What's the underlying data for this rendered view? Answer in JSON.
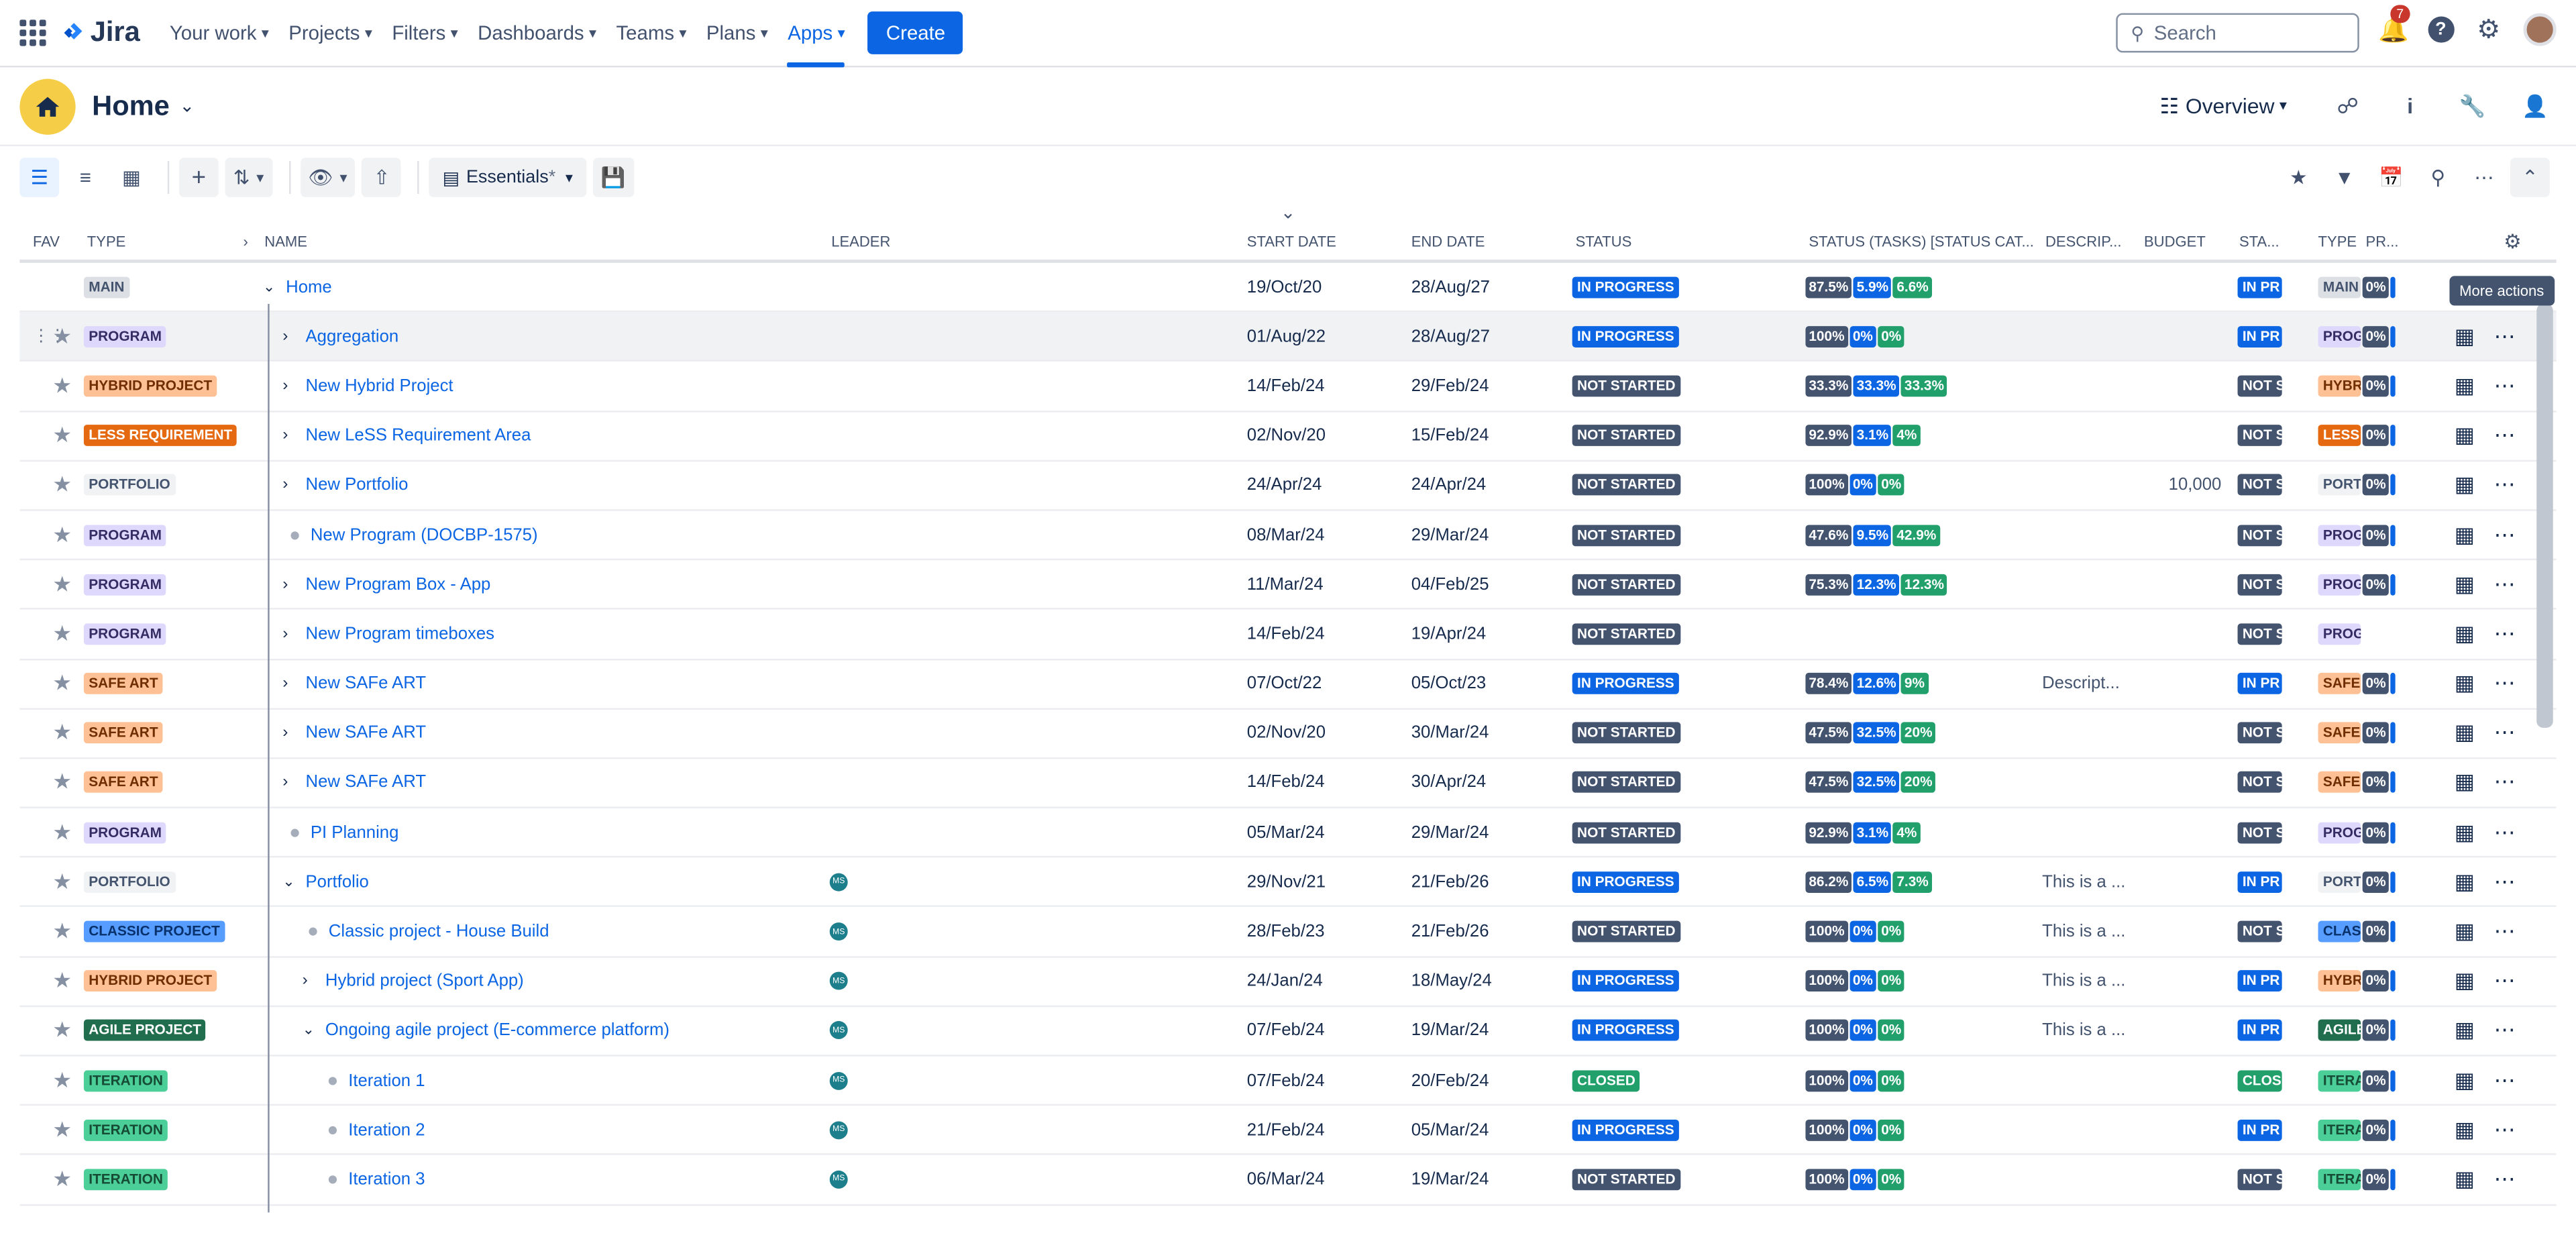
{
  "topnav": {
    "logo": "Jira",
    "items": [
      {
        "label": "Your work"
      },
      {
        "label": "Projects"
      },
      {
        "label": "Filters"
      },
      {
        "label": "Dashboards"
      },
      {
        "label": "Teams"
      },
      {
        "label": "Plans"
      },
      {
        "label": "Apps"
      }
    ],
    "create_label": "Create",
    "search_placeholder": "Search",
    "notification_count": "7"
  },
  "header": {
    "title": "Home",
    "view_label": "Overview"
  },
  "toolbar": {
    "view_name": "Essentials",
    "view_modified_mark": "*"
  },
  "columns": {
    "fav": "FAV",
    "type": "TYPE",
    "name": "NAME",
    "leader": "LEADER",
    "start_date": "START DATE",
    "end_date": "END DATE",
    "status": "STATUS",
    "status_tasks": "STATUS (TASKS) [STATUS CAT...",
    "description": "DESCRIP...",
    "budget": "BUDGET",
    "sta": "STA...",
    "type2": "TYPE",
    "pr": "PR..."
  },
  "tooltip": "More actions",
  "rows": [
    {
      "type": "MAIN",
      "name": "Home",
      "start": "19/Oct/20",
      "end": "28/Aug/27",
      "status": "IN PROGRESS",
      "p": [
        "87.5%",
        "5.9%",
        "6.6%"
      ],
      "desc": "",
      "budget": "",
      "sta": "IN PR",
      "type_short": "MAIN",
      "pr": "0%"
    },
    {
      "type": "PROGRAM",
      "name": "Aggregation",
      "start": "01/Aug/22",
      "end": "28/Aug/27",
      "status": "IN PROGRESS",
      "p": [
        "100%",
        "0%",
        "0%"
      ],
      "desc": "",
      "budget": "",
      "sta": "IN PR",
      "type_short": "PROG",
      "pr": "0%"
    },
    {
      "type": "HYBRID PROJECT",
      "name": "New Hybrid Project",
      "start": "14/Feb/24",
      "end": "29/Feb/24",
      "status": "NOT STARTED",
      "p": [
        "33.3%",
        "33.3%",
        "33.3%"
      ],
      "desc": "",
      "budget": "",
      "sta": "NOT S",
      "type_short": "HYBR",
      "pr": "0%"
    },
    {
      "type": "LESS REQUIREMENT",
      "name": "New LeSS Requirement Area",
      "start": "02/Nov/20",
      "end": "15/Feb/24",
      "status": "NOT STARTED",
      "p": [
        "92.9%",
        "3.1%",
        "4%"
      ],
      "desc": "",
      "budget": "",
      "sta": "NOT S",
      "type_short": "LESS",
      "pr": "0%"
    },
    {
      "type": "PORTFOLIO",
      "name": "New Portfolio",
      "start": "24/Apr/24",
      "end": "24/Apr/24",
      "status": "NOT STARTED",
      "p": [
        "100%",
        "0%",
        "0%"
      ],
      "desc": "",
      "budget": "10,000",
      "sta": "NOT S",
      "type_short": "PORT",
      "pr": "0%"
    },
    {
      "type": "PROGRAM",
      "name": "New Program (DOCBP-1575)",
      "start": "08/Mar/24",
      "end": "29/Mar/24",
      "status": "NOT STARTED",
      "p": [
        "47.6%",
        "9.5%",
        "42.9%"
      ],
      "desc": "",
      "budget": "",
      "sta": "NOT S",
      "type_short": "PROG",
      "pr": "0%"
    },
    {
      "type": "PROGRAM",
      "name": "New Program Box - App",
      "start": "11/Mar/24",
      "end": "04/Feb/25",
      "status": "NOT STARTED",
      "p": [
        "75.3%",
        "12.3%",
        "12.3%"
      ],
      "desc": "",
      "budget": "",
      "sta": "NOT S",
      "type_short": "PROG",
      "pr": "0%"
    },
    {
      "type": "PROGRAM",
      "name": "New Program timeboxes",
      "start": "14/Feb/24",
      "end": "19/Apr/24",
      "status": "NOT STARTED",
      "p": [
        "",
        "",
        ""
      ],
      "desc": "",
      "budget": "",
      "sta": "NOT S",
      "type_short": "PROG",
      "pr": ""
    },
    {
      "type": "SAFE ART",
      "name": "New SAFe ART",
      "start": "07/Oct/22",
      "end": "05/Oct/23",
      "status": "IN PROGRESS",
      "p": [
        "78.4%",
        "12.6%",
        "9%"
      ],
      "desc": "Descript...",
      "budget": "",
      "sta": "IN PR",
      "type_short": "SAFE",
      "pr": "0%"
    },
    {
      "type": "SAFE ART",
      "name": "New SAFe ART",
      "start": "02/Nov/20",
      "end": "30/Mar/24",
      "status": "NOT STARTED",
      "p": [
        "47.5%",
        "32.5%",
        "20%"
      ],
      "desc": "",
      "budget": "",
      "sta": "NOT S",
      "type_short": "SAFE",
      "pr": "0%"
    },
    {
      "type": "SAFE ART",
      "name": "New SAFe ART",
      "start": "14/Feb/24",
      "end": "30/Apr/24",
      "status": "NOT STARTED",
      "p": [
        "47.5%",
        "32.5%",
        "20%"
      ],
      "desc": "",
      "budget": "",
      "sta": "NOT S",
      "type_short": "SAFE",
      "pr": "0%"
    },
    {
      "type": "PROGRAM",
      "name": "PI Planning",
      "start": "05/Mar/24",
      "end": "29/Mar/24",
      "status": "NOT STARTED",
      "p": [
        "92.9%",
        "3.1%",
        "4%"
      ],
      "desc": "",
      "budget": "",
      "sta": "NOT S",
      "type_short": "PROG",
      "pr": "0%"
    },
    {
      "type": "PORTFOLIO",
      "name": "Portfolio",
      "leader": "MS",
      "start": "29/Nov/21",
      "end": "21/Feb/26",
      "status": "IN PROGRESS",
      "p": [
        "86.2%",
        "6.5%",
        "7.3%"
      ],
      "desc": "This is a ...",
      "budget": "",
      "sta": "IN PR",
      "type_short": "PORT",
      "pr": "0%"
    },
    {
      "type": "CLASSIC PROJECT",
      "name": "Classic project - House Build",
      "leader": "MS",
      "start": "28/Feb/23",
      "end": "21/Feb/26",
      "status": "NOT STARTED",
      "p": [
        "100%",
        "0%",
        "0%"
      ],
      "desc": "This is a ...",
      "budget": "",
      "sta": "NOT S",
      "type_short": "CLAS",
      "pr": "0%"
    },
    {
      "type": "HYBRID PROJECT",
      "name": "Hybrid project (Sport App)",
      "leader": "MS",
      "start": "24/Jan/24",
      "end": "18/May/24",
      "status": "IN PROGRESS",
      "p": [
        "100%",
        "0%",
        "0%"
      ],
      "desc": "This is a ...",
      "budget": "",
      "sta": "IN PR",
      "type_short": "HYBR",
      "pr": "0%"
    },
    {
      "type": "AGILE PROJECT",
      "name": "Ongoing agile project (E-commerce platform)",
      "leader": "MS",
      "start": "07/Feb/24",
      "end": "19/Mar/24",
      "status": "IN PROGRESS",
      "p": [
        "100%",
        "0%",
        "0%"
      ],
      "desc": "This is a ...",
      "budget": "",
      "sta": "IN PR",
      "type_short": "AGILE",
      "pr": "0%"
    },
    {
      "type": "ITERATION",
      "name": "Iteration 1",
      "leader": "MS",
      "start": "07/Feb/24",
      "end": "20/Feb/24",
      "status": "CLOSED",
      "p": [
        "100%",
        "0%",
        "0%"
      ],
      "desc": "",
      "budget": "",
      "sta": "CLOS",
      "type_short": "ITERA",
      "pr": "0%"
    },
    {
      "type": "ITERATION",
      "name": "Iteration 2",
      "leader": "MS",
      "start": "21/Feb/24",
      "end": "05/Mar/24",
      "status": "IN PROGRESS",
      "p": [
        "100%",
        "0%",
        "0%"
      ],
      "desc": "",
      "budget": "",
      "sta": "IN PR",
      "type_short": "ITERA",
      "pr": "0%"
    },
    {
      "type": "ITERATION",
      "name": "Iteration 3",
      "leader": "MS",
      "start": "06/Mar/24",
      "end": "19/Mar/24",
      "status": "NOT STARTED",
      "p": [
        "100%",
        "0%",
        "0%"
      ],
      "desc": "",
      "budget": "",
      "sta": "NOT S",
      "type_short": "ITERA",
      "pr": "0%"
    }
  ]
}
